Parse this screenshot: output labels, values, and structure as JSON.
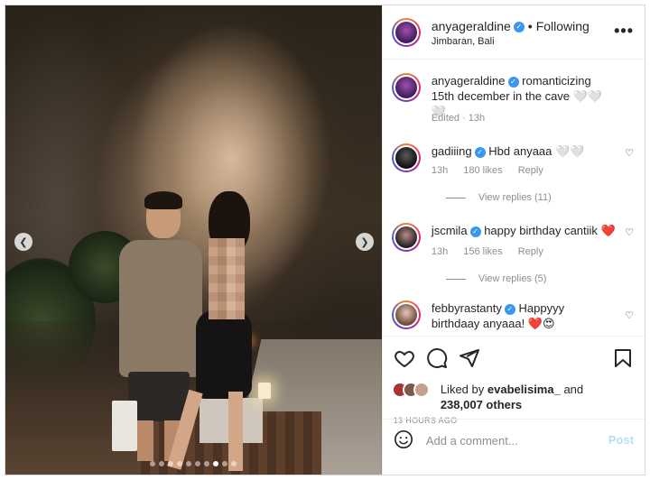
{
  "header": {
    "username": "anyageraldine",
    "separator": "•",
    "follow_status": "Following",
    "location": "Jimbaran, Bali",
    "more_icon": "more-horizontal-icon"
  },
  "caption": {
    "username": "anyageraldine",
    "text": "romanticizing 15th december in the cave 🤍🤍🤍",
    "meta": "Edited · 13h"
  },
  "comments": [
    {
      "username": "gadiiing",
      "text": "Hbd anyaaa 🤍🤍",
      "time": "13h",
      "likes": "180 likes",
      "reply": "Reply",
      "view_replies": "View replies (11)"
    },
    {
      "username": "jscmila",
      "text": "happy birthday cantiik ❤️",
      "time": "13h",
      "likes": "156 likes",
      "reply": "Reply",
      "view_replies": "View replies (5)"
    },
    {
      "username": "febbyrastanty",
      "text": "Happyyy birthdaay anyaaa! ❤️😍"
    }
  ],
  "likes": {
    "prefix": "Liked by",
    "user": "evabelisima_",
    "and": "and",
    "count": "238,007 others"
  },
  "timestamp": "13 HOURS AGO",
  "comment_box": {
    "placeholder": "Add a comment...",
    "post_label": "Post"
  },
  "carousel": {
    "total_slides": 10,
    "active_index": 7
  },
  "colors": {
    "verified": "#3897f0",
    "post_button": "#b2dffc",
    "muted": "#8e8e8e"
  }
}
